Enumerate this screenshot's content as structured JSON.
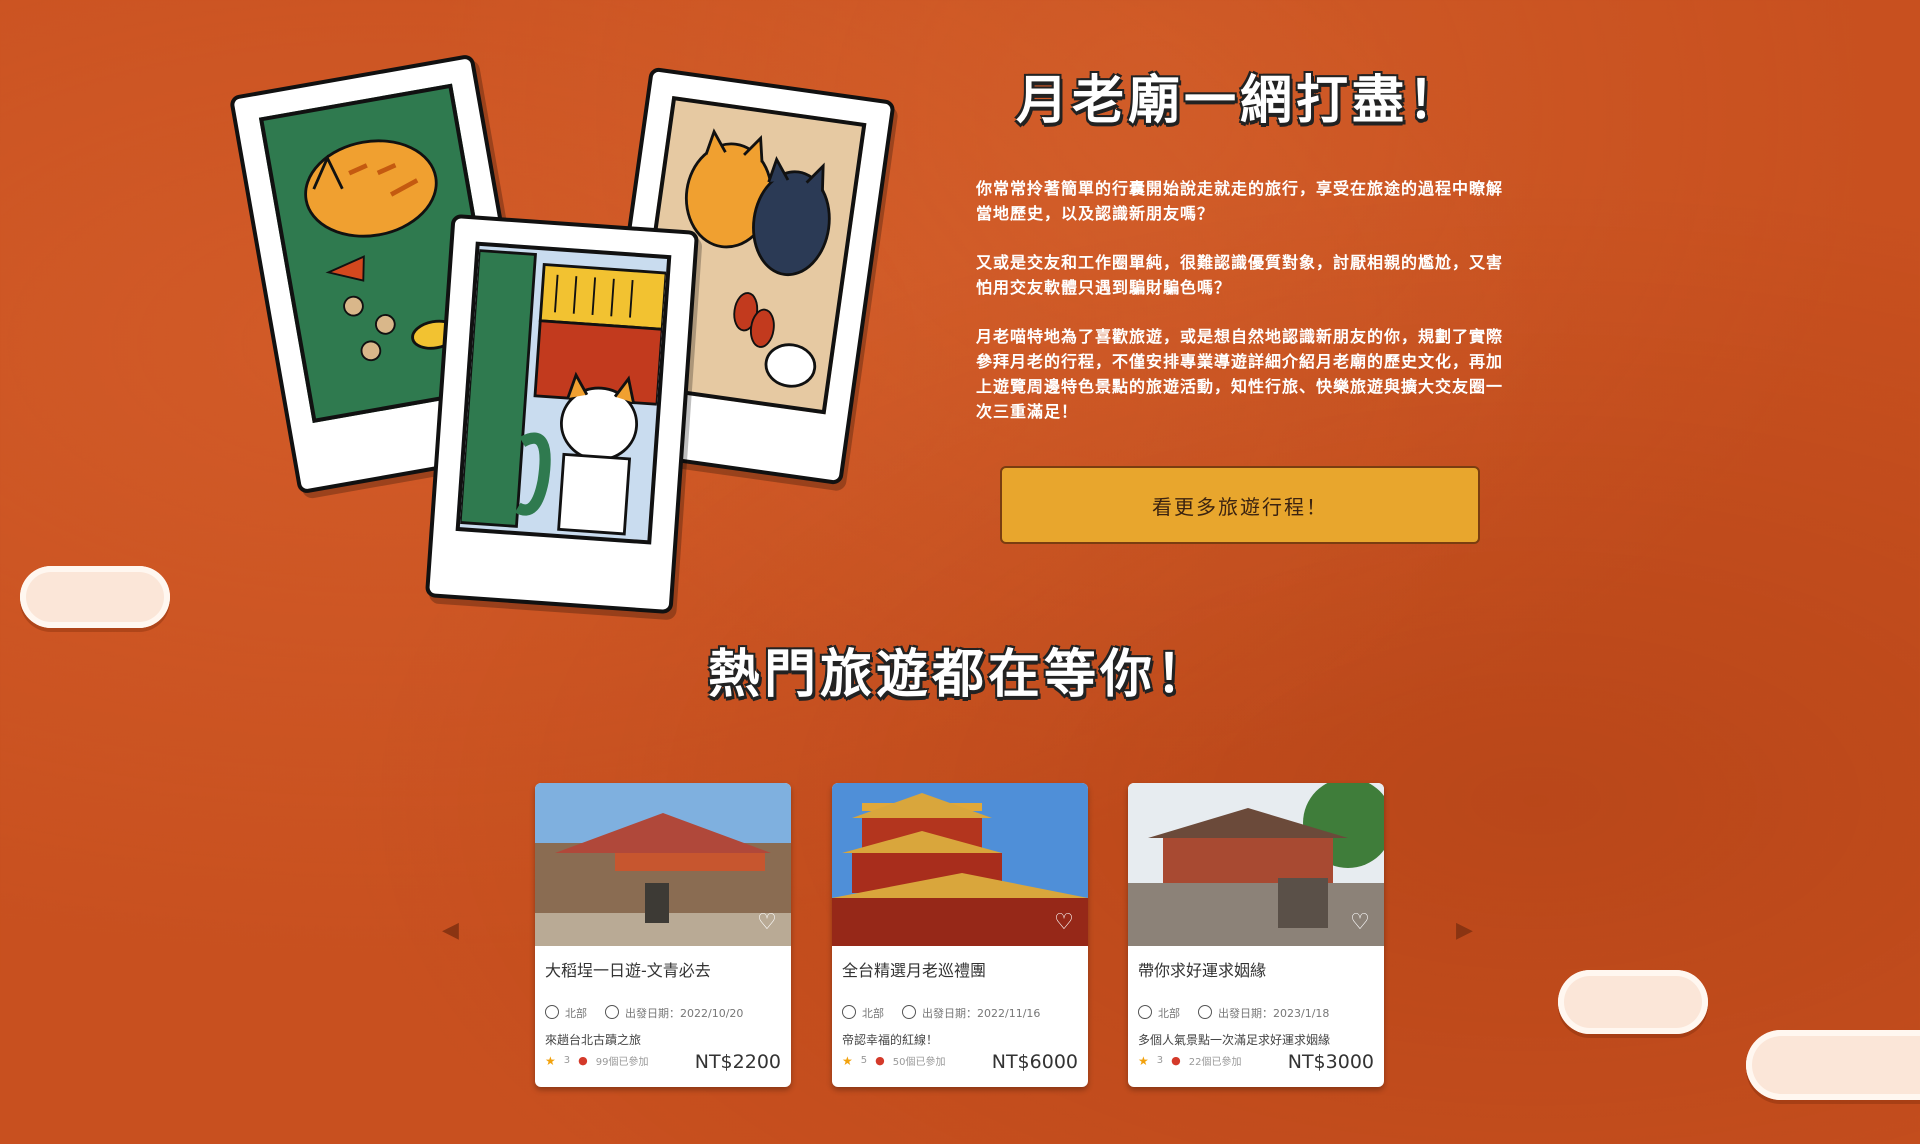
{
  "section1": {
    "title": "月老廟一網打盡！",
    "paragraphs": [
      "你常常拎著簡單的行囊開始說走就走的旅行，享受在旅途的過程中瞭解當地歷史，以及認識新朋友嗎？",
      "又或是交友和工作圈單純，很難認識優質對象，討厭相親的尷尬，又害怕用交友軟體只遇到騙財騙色嗎？",
      "月老喵特地為了喜歡旅遊，或是想自然地認識新朋友的你，規劃了實際參拜月老的行程，不僅安排專業導遊詳細介紹月老廟的歷史文化，再加上遊覽周邊特色景點的旅遊活動，知性行旅、快樂旅遊與擴大交友圈一次三重滿足！"
    ],
    "cta_label": "看更多旅遊行程！"
  },
  "section2": {
    "title": "熱門旅遊都在等你！",
    "prev_arrow": "◀",
    "next_arrow": "▶",
    "cards": [
      {
        "name": "大稻埕一日遊-文青必去",
        "region": "北部",
        "date": "出發日期：2022/10/20",
        "desc": "來趟台北古蹟之旅",
        "rating": "3",
        "joined": "99個已參加",
        "price": "NT$2200"
      },
      {
        "name": "全台精選月老巡禮團",
        "region": "北部",
        "date": "出發日期：2022/11/16",
        "desc": "帝認幸福的紅線！",
        "rating": "5",
        "joined": "50個已參加",
        "price": "NT$6000"
      },
      {
        "name": "帶你求好運求姻緣",
        "region": "北部",
        "date": "出發日期：2023/1/18",
        "desc": "多個人氣景點一次滿足求好運求姻緣",
        "rating": "3",
        "joined": "22個已參加",
        "price": "NT$3000"
      }
    ]
  }
}
